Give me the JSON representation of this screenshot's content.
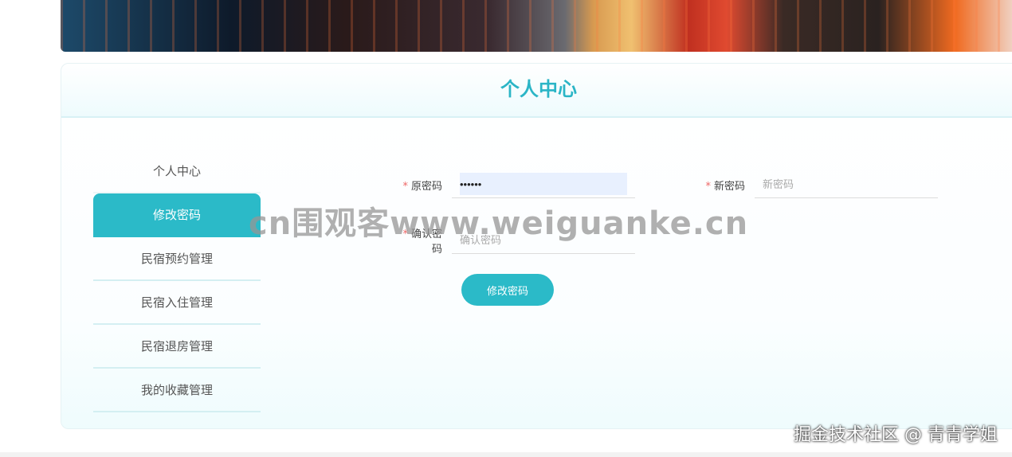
{
  "panel": {
    "title": "个人中心"
  },
  "sidebar": {
    "items": [
      {
        "label": "个人中心"
      },
      {
        "label": "修改密码"
      },
      {
        "label": "民宿预约管理"
      },
      {
        "label": "民宿入住管理"
      },
      {
        "label": "民宿退房管理"
      },
      {
        "label": "我的收藏管理"
      }
    ]
  },
  "form": {
    "required_mark": "*",
    "old_password": {
      "label": "原密码",
      "value": "••••••"
    },
    "new_password": {
      "label": "新密码",
      "placeholder": "新密码"
    },
    "confirm_password": {
      "label": "确认密码",
      "placeholder": "确认密码"
    },
    "submit_label": "修改密码"
  },
  "watermarks": {
    "center": "cn围观客www.weiguanke.cn",
    "corner": "掘金技术社区 @ 青青学姐"
  }
}
